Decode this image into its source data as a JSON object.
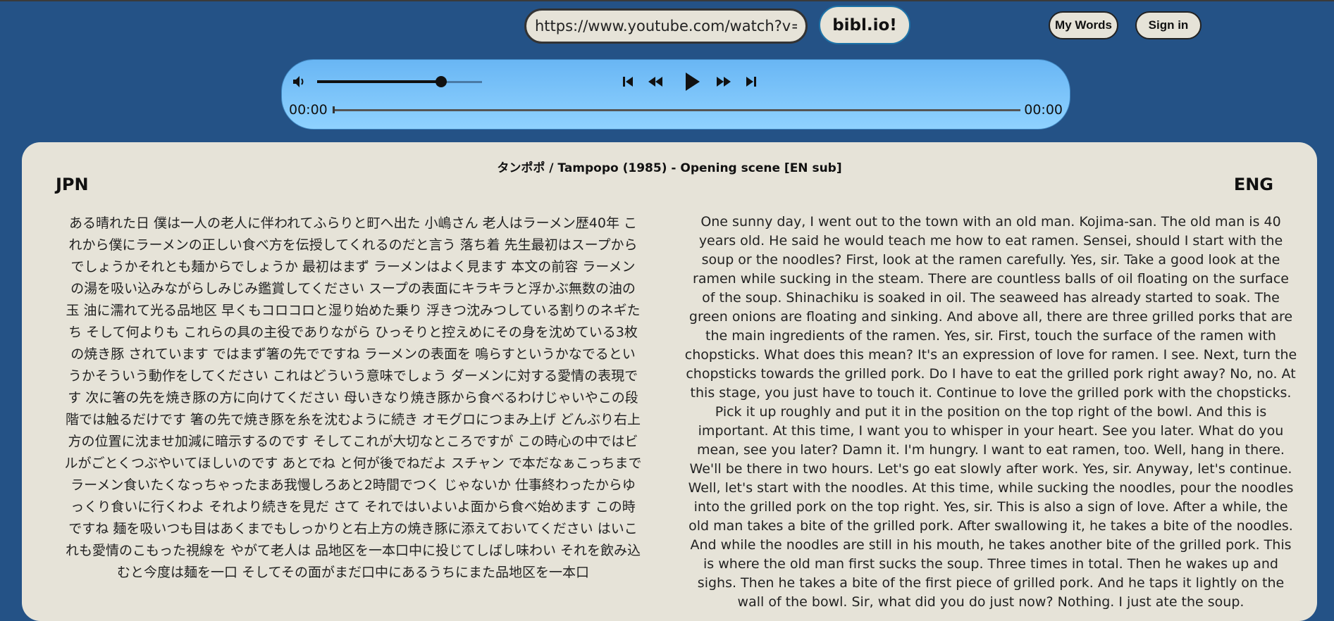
{
  "header": {
    "url_value": "https://www.youtube.com/watch?v=DeVhZ",
    "go_label": "bibl.io!",
    "my_words_label": "My Words",
    "sign_in_label": "Sign in"
  },
  "player": {
    "volume": 0.75,
    "progress": 0,
    "current_time": "00:00",
    "duration": "00:00",
    "icons": [
      "volume-icon",
      "skip-previous-icon",
      "rewind-icon",
      "play-icon",
      "fast-forward-icon",
      "skip-next-icon"
    ]
  },
  "content": {
    "video_title": "タンポポ / Tampopo (1985) - Opening scene [EN sub]",
    "left_label": "JPN",
    "right_label": "ENG",
    "japanese_text": "ある晴れた日 僕は一人の老人に伴われてふらりと町へ出た 小嶋さん 老人はラーメン歴40年 これから僕にラーメンの正しい食べ方を伝授してくれるのだと言う 落ち着 先生最初はスープからでしょうかそれとも麺からでしょうか 最初はまず ラーメンはよく見ます 本文の前容 ラーメンの湯を吸い込みながらしみじみ鑑賞してください スープの表面にキラキラと浮かぶ無数の油の玉 油に濡れて光る品地区 早くもコロコロと湿り始めた乗り 浮きつ沈みつしている割りのネギたち そして何よりも これらの具の主役でありながら ひっそりと控えめにその身を沈めている3枚の焼き豚 されています ではまず箸の先でですね ラーメンの表面を 嗚らすというかなでるというかそういう動作をしてください これはどういう意味でしょう ダーメンに対する愛情の表現です 次に箸の先を焼き豚の方に向けてください 母いきなり焼き豚から食べるわけじゃいやこの段階では触るだけです 箸の先で焼き豚を糸を沈むように続き オモグロにつまみ上げ どんぶり右上方の位置に沈ませ加減に暗示するのです そしてこれが大切なところですが この時心の中ではビルがごとくつぶやいてほしいのです あとでね と何が後でねだよ スチャン で本だなぁこっちまでラーメン食いたくなっちゃったまあ我慢しろあと2時間でつく じゃないか 仕事終わったからゆっくり食いに行くわよ それより続きを見だ さて それではいよいよ面から食べ始めます この時ですね 麺を吸いつも目はあくまでもしっかりと右上方の焼き豚に添えておいてください はいこれも愛情のこもった視線を やがて老人は 品地区を一本口中に投じてしばし味わい それを飲み込むと今度は麺を一口 そしてその面がまだ口中にあるうちにまた品地区を一本口",
    "english_text": "One sunny day, I went out to the town with an old man. Kojima-san. The old man is 40 years old. He said he would teach me how to eat ramen. Sensei, should I start with the soup or the noodles? First, look at the ramen carefully. Yes, sir. Take a good look at the ramen while sucking in the steam. There are countless balls of oil floating on the surface of the soup. Shinachiku is soaked in oil. The seaweed has already started to soak. The green onions are floating and sinking. And above all, there are three grilled porks that are the main ingredients of the ramen. Yes, sir. First, touch the surface of the ramen with chopsticks. What does this mean? It's an expression of love for ramen. I see. Next, turn the chopsticks towards the grilled pork. Do I have to eat the grilled pork right away? No, no. At this stage, you just have to touch it. Continue to love the grilled pork with the chopsticks. Pick it up roughly and put it in the position on the top right of the bowl. And this is important. At this time, I want you to whisper in your heart. See you later. What do you mean, see you later? Damn it. I'm hungry. I want to eat ramen, too. Well, hang in there. We'll be there in two hours. Let's go eat slowly after work. Yes, sir. Anyway, let's continue. Well, let's start with the noodles. At this time, while sucking the noodles, pour the noodles into the grilled pork on the top right. Yes, sir. This is also a sign of love. After a while, the old man takes a bite of the grilled pork. After swallowing it, he takes a bite of the noodles. And while the noodles are still in his mouth, he takes another bite of the grilled pork. This is where the old man first sucks the soup. Three times in total. Then he wakes up and sighs. Then he takes a bite of the first piece of grilled pork. And he taps it lightly on the wall of the bowl. Sir, what did you do just now? Nothing. I just ate the soup."
  }
}
